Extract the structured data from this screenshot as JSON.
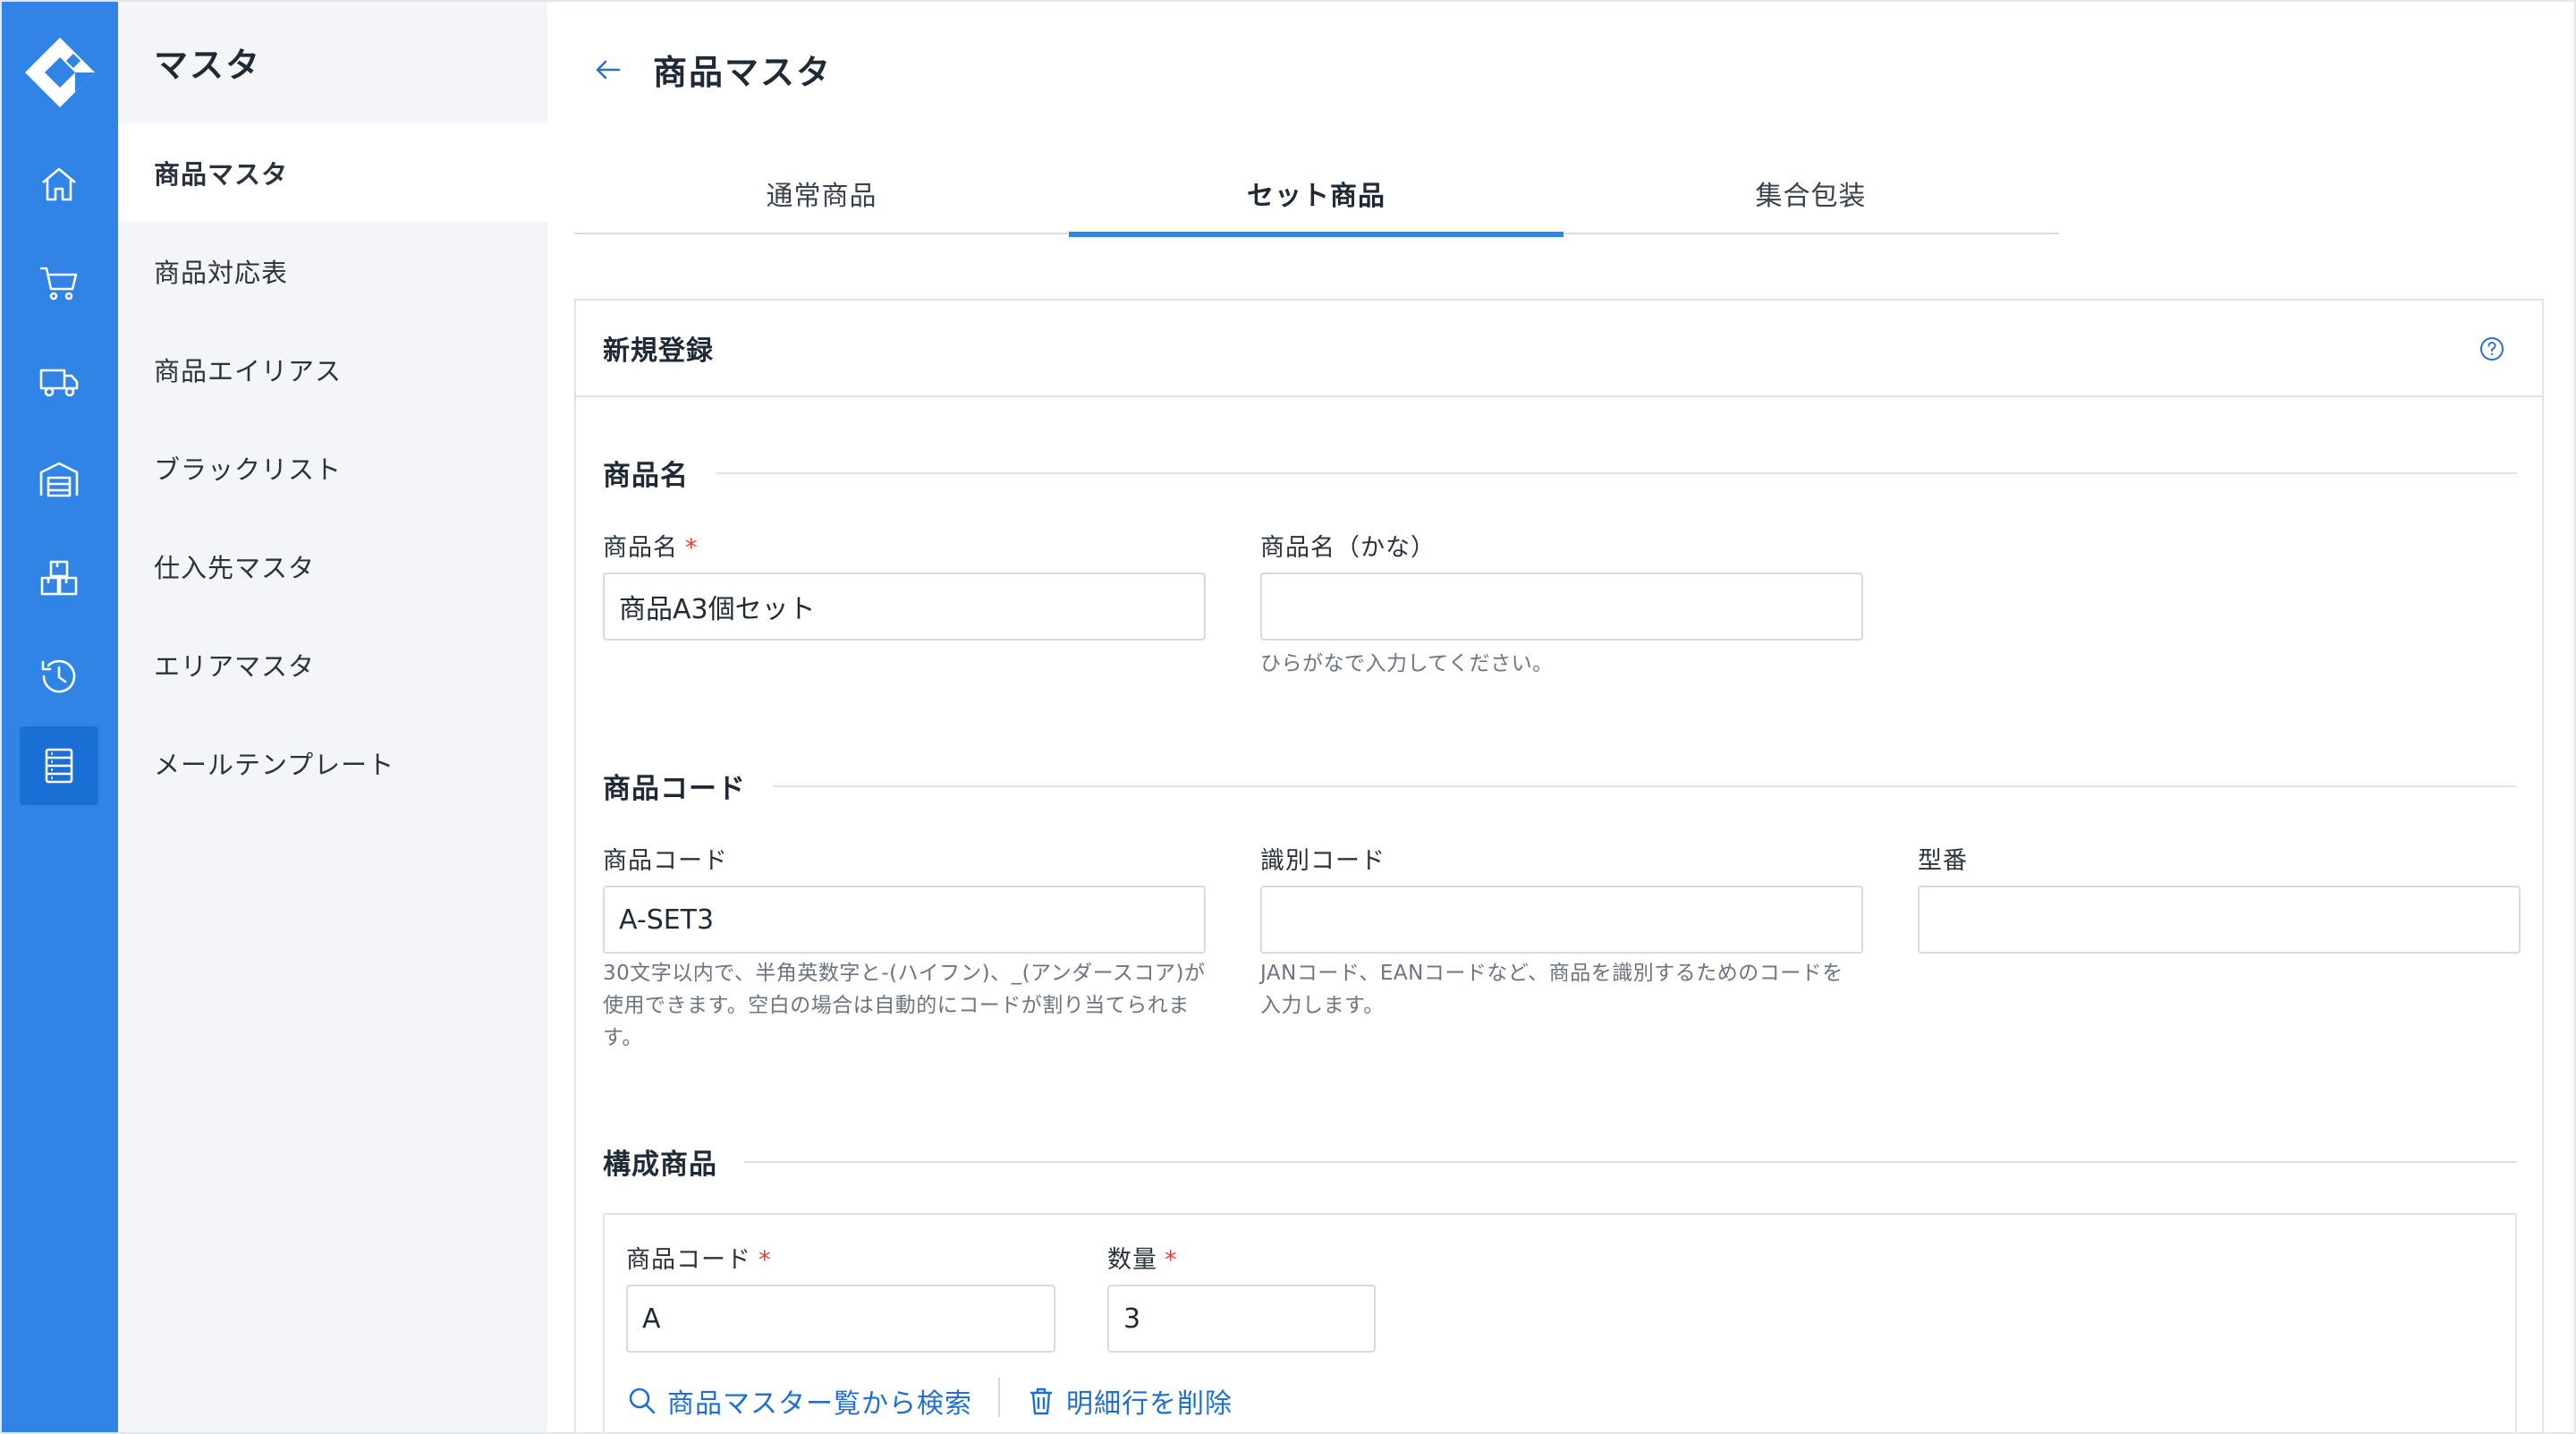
{
  "rail": {
    "icons": [
      "logo-icon",
      "home-icon",
      "cart-icon",
      "truck-icon",
      "warehouse-icon",
      "boxes-icon",
      "history-icon",
      "master-list-icon"
    ],
    "accent": "#2f84e6",
    "active_bg": "#1a6fd4"
  },
  "sidebar": {
    "title": "マスタ",
    "items": [
      {
        "label": "商品マスタ",
        "active": true
      },
      {
        "label": "商品対応表"
      },
      {
        "label": "商品エイリアス"
      },
      {
        "label": "ブラックリスト"
      },
      {
        "label": "仕入先マスタ"
      },
      {
        "label": "エリアマスタ"
      },
      {
        "label": "メールテンプレート"
      }
    ]
  },
  "header": {
    "title": "商品マスタ"
  },
  "tabs": [
    {
      "label": "通常商品"
    },
    {
      "label": "セット商品",
      "active": true
    },
    {
      "label": "集合包装"
    }
  ],
  "form": {
    "card_title": "新規登録",
    "sections": {
      "name": {
        "title": "商品名",
        "name_label": "商品名",
        "name_value": "商品A3個セット",
        "kana_label": "商品名（かな）",
        "kana_value": "",
        "kana_hint": "ひらがなで入力してください。"
      },
      "code": {
        "title": "商品コード",
        "code_label": "商品コード",
        "code_value": "A-SET3",
        "code_hint_1": "30文字以内で、半角英数字と-(ハイフン)、_(アンダースコア)が",
        "code_hint_2": "使用できます。空白の場合は自動的にコードが割り当てられま",
        "code_hint_3": "す。",
        "ident_label": "識別コード",
        "ident_value": "",
        "ident_hint_1": "JANコード、EANコードなど、商品を識別するためのコードを",
        "ident_hint_2": "入力します。",
        "model_label": "型番",
        "model_value": ""
      },
      "components": {
        "title": "構成商品",
        "code_label": "商品コード",
        "code_value": "A",
        "qty_label": "数量",
        "qty_value": "3",
        "search_label": "商品マスター覧から検索",
        "delete_label": "明細行を削除"
      }
    },
    "required_mark": "*"
  },
  "colors": {
    "required": "#e0433a",
    "link": "#1f6fd0"
  }
}
